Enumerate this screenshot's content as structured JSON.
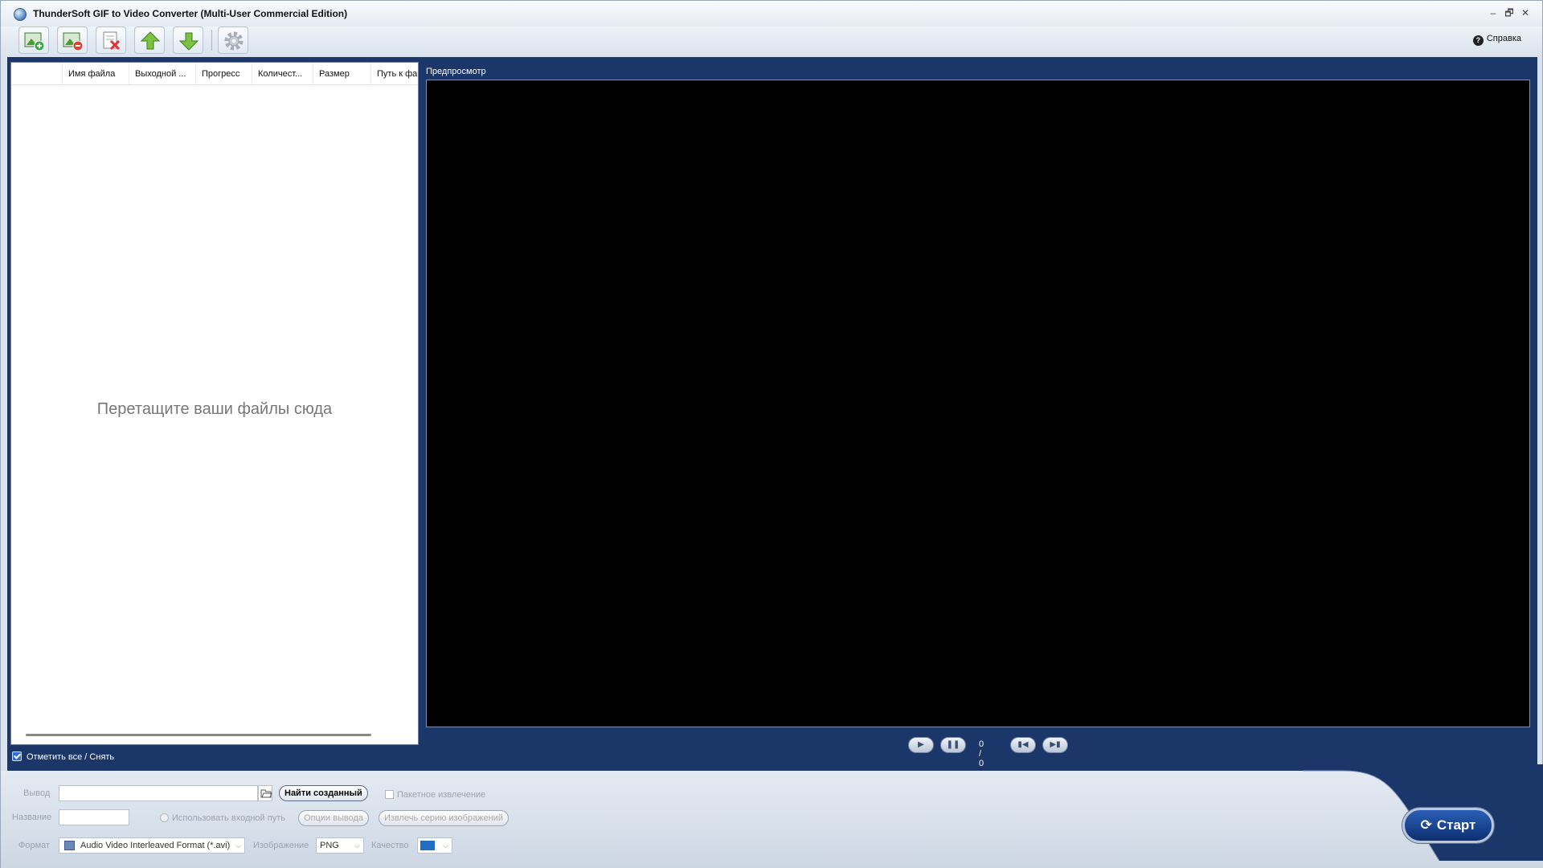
{
  "window": {
    "title": "ThunderSoft GIF to Video Converter (Multi-User Commercial Edition)",
    "controls": [
      "–",
      "🗗",
      "✕"
    ]
  },
  "toolbar": {
    "buttons": [
      {
        "name": "add-files",
        "icon": "image-add-icon"
      },
      {
        "name": "remove-file",
        "icon": "image-remove-icon"
      },
      {
        "name": "clear-list",
        "icon": "delete-list-icon"
      },
      {
        "name": "move-up",
        "icon": "arrow-up-icon"
      },
      {
        "name": "move-down",
        "icon": "arrow-down-icon"
      },
      {
        "name": "settings",
        "icon": "gear-icon"
      }
    ],
    "help_label": "Справка"
  },
  "filelist": {
    "columns": [
      "Имя файла",
      "Выходной ...",
      "Прогресс",
      "Количест...",
      "Размер",
      "Путь к фа"
    ],
    "drop_hint": "Перетащите ваши файлы сюда",
    "check_all_label": "Отметить все / Снять"
  },
  "preview": {
    "label": "Предпросмотр",
    "counter": "0 / 0"
  },
  "output": {
    "output_label": "Вывод",
    "output_value": "",
    "find_button": "Найти созданный",
    "batch_extract_label": "Пакетное извлечение",
    "name_label": "Название",
    "name_value": "",
    "use_input_path_label": "Использовать входной путь",
    "output_options_button": "Опции вывода",
    "extract_series_button": "Извлечь серию изображений",
    "format_label": "Формат",
    "format_value": "Audio Video Interleaved Format (*.avi)",
    "image_label": "Изображение",
    "image_value": "PNG",
    "quality_label": "Качество",
    "quality_color": "#1f6fc4"
  },
  "start_button": "Старт"
}
